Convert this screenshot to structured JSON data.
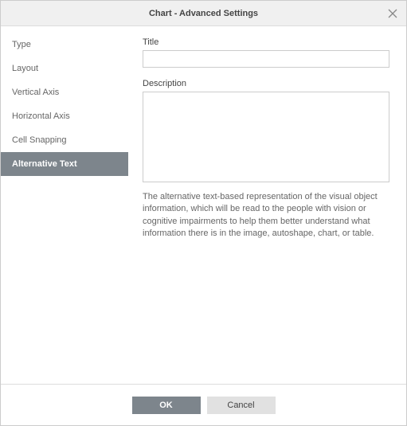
{
  "dialog": {
    "title": "Chart - Advanced Settings"
  },
  "sidebar": {
    "items": [
      {
        "label": "Type",
        "selected": false
      },
      {
        "label": "Layout",
        "selected": false
      },
      {
        "label": "Vertical Axis",
        "selected": false
      },
      {
        "label": "Horizontal Axis",
        "selected": false
      },
      {
        "label": "Cell Snapping",
        "selected": false
      },
      {
        "label": "Alternative Text",
        "selected": true
      }
    ]
  },
  "form": {
    "title_label": "Title",
    "title_value": "",
    "description_label": "Description",
    "description_value": "",
    "help_text": "The alternative text-based representation of the visual object information, which will be read to the people with vision or cognitive impairments to help them better understand what information there is in the image, autoshape, chart, or table."
  },
  "footer": {
    "ok_label": "OK",
    "cancel_label": "Cancel"
  }
}
